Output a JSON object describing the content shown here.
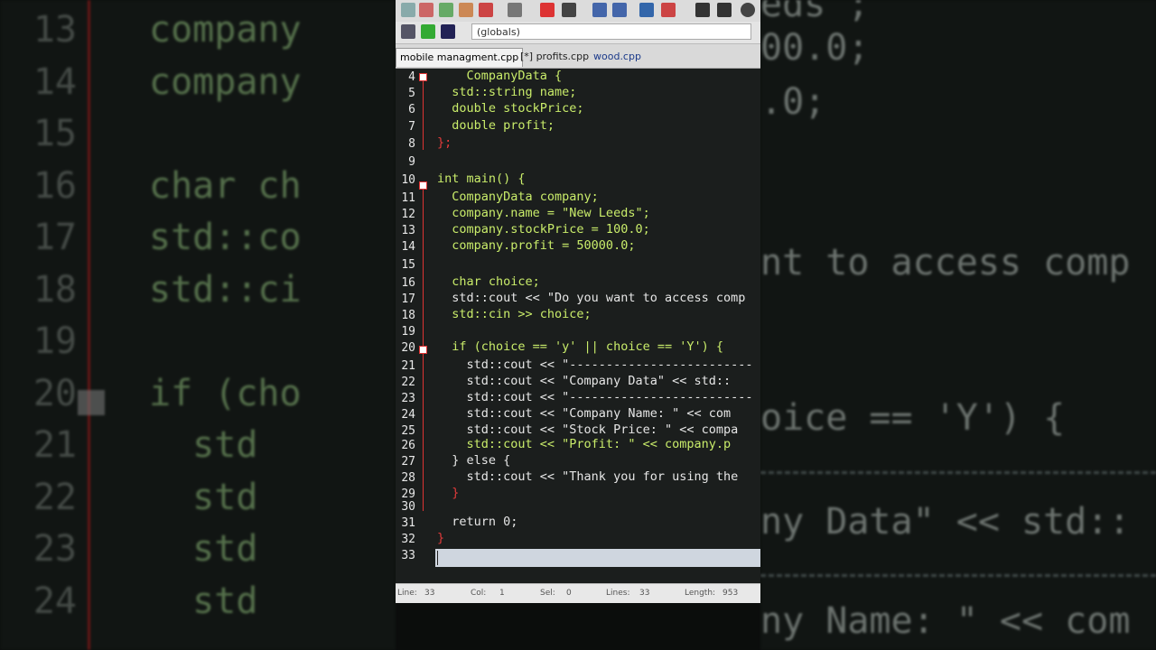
{
  "background_left": {
    "lines": [
      {
        "num": "13",
        "text": "company"
      },
      {
        "num": "14",
        "text": "company"
      },
      {
        "num": "15",
        "text": ""
      },
      {
        "num": "16",
        "text": "char ch"
      },
      {
        "num": "17",
        "text": "std::co"
      },
      {
        "num": "18",
        "text": "std::ci"
      },
      {
        "num": "19",
        "text": ""
      },
      {
        "num": "20",
        "text": "if (cho"
      },
      {
        "num": "21",
        "text": "  std"
      },
      {
        "num": "22",
        "text": "  std"
      },
      {
        "num": "23",
        "text": "  std"
      },
      {
        "num": "24",
        "text": "  std"
      }
    ]
  },
  "background_right": {
    "lines": [
      {
        "text": "eds\";"
      },
      {
        "text": "00.0;"
      },
      {
        "text": ".0;"
      },
      {
        "text": "nt to access comp"
      },
      {
        "text": "oice == 'Y') {"
      },
      {
        "text": "ny Data\" << std::"
      },
      {
        "text": "ny Name: \" << com"
      }
    ]
  },
  "toolbar": {
    "scope": "(globals)"
  },
  "tabs": [
    {
      "label": "mobile managment.cpp",
      "active": true
    },
    {
      "label": "[*] profits.cpp",
      "active": false
    },
    {
      "label": "wood.cpp",
      "active": false
    }
  ],
  "editor": {
    "line_numbers": [
      "4",
      "5",
      "6",
      "7",
      "8",
      "9",
      "10",
      "11",
      "12",
      "13",
      "14",
      "15",
      "16",
      "17",
      "18",
      "19",
      "20",
      "21",
      "22",
      "23",
      "24",
      "25",
      "26",
      "27",
      "28",
      "29",
      "30",
      "31",
      "32",
      "33"
    ],
    "lines": [
      "    CompanyData {",
      "  std::string name;",
      "  double stockPrice;",
      "  double profit;",
      "};",
      "",
      "int main() {",
      "  CompanyData company;",
      "  company.name = \"New Leeds\";",
      "  company.stockPrice = 100.0;",
      "  company.profit = 50000.0;",
      "",
      "  char choice;",
      "  std::cout << \"Do you want to access comp",
      "  std::cin >> choice;",
      "",
      "  if (choice == 'y' || choice == 'Y') {",
      "    std::cout << \"-------------------------",
      "    std::cout << \"Company Data\" << std::",
      "    std::cout << \"-------------------------",
      "    std::cout << \"Company Name: \" << com",
      "    std::cout << \"Stock Price: \" << compa",
      "    std::cout << \"Profit: \" << company.p",
      "  } else {",
      "    std::cout << \"Thank you for using the",
      "  }",
      "",
      "  return 0;",
      "}",
      ""
    ]
  },
  "statusbar": {
    "line_label": "Line:",
    "line_value": "33",
    "col_label": "Col:",
    "col_value": "1",
    "sel_label": "Sel:",
    "sel_value": "0",
    "lines_label": "Lines:",
    "lines_value": "33",
    "length_label": "Length:",
    "length_value": "953"
  }
}
